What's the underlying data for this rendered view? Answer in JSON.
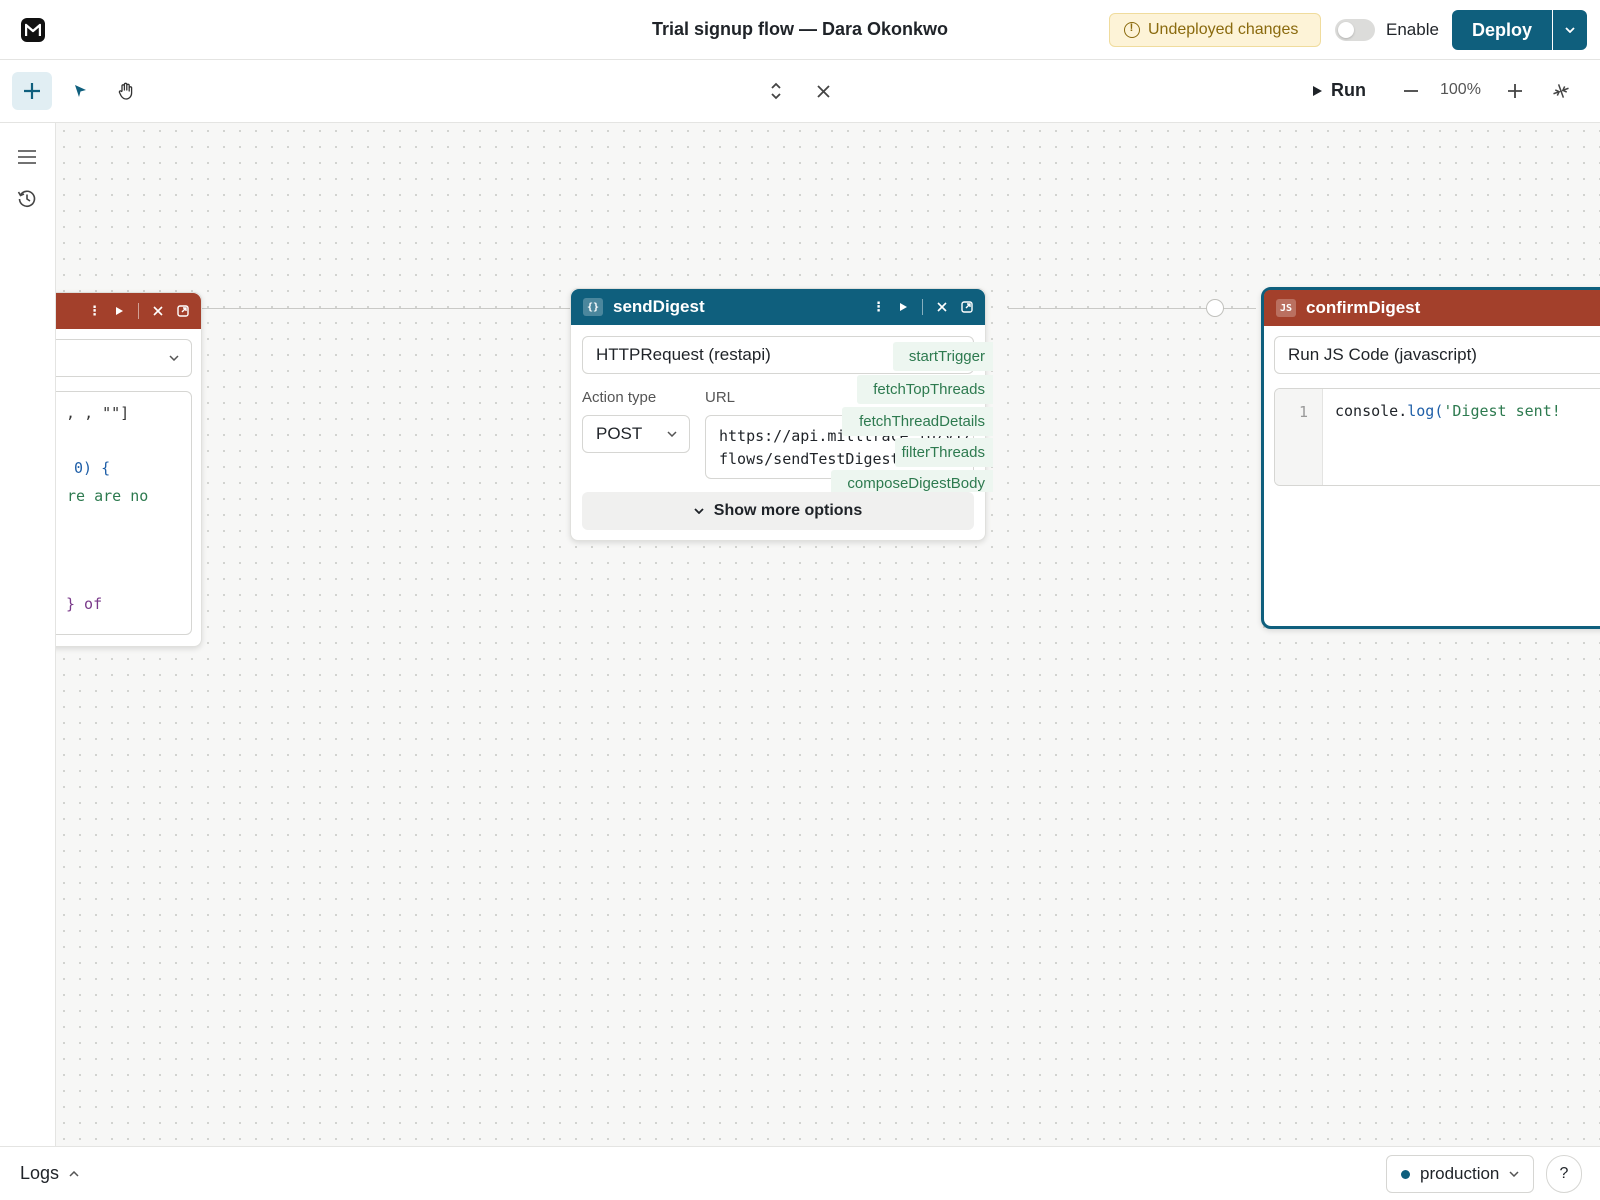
{
  "header": {
    "title": "Trial signup flow — Dara Okonkwo",
    "badge_label": "Undeployed changes",
    "enable_label": "Enable",
    "deploy_label": "Deploy"
  },
  "toolbar": {
    "run_label": "Run",
    "zoom_label": "100%"
  },
  "nodes": {
    "left": {
      "code_lines": [
        ", \"\"]",
        "0) {",
        "re are no",
        "} of"
      ]
    },
    "send_digest": {
      "name": "sendDigest",
      "type_icon": "{}",
      "resource": "HTTPRequest (restapi)",
      "action_type_label": "Action type",
      "action_type_value": "POST",
      "url_label": "URL",
      "url_line1": "https://api.milltrace.io/v1/",
      "url_line2": "flows/sendTestDigest",
      "show_more_label": "Show more options",
      "suggestions": [
        "startTrigger",
        "fetchTopThreads",
        "fetchThreadDetails",
        "filterThreads",
        "composeDigestBody"
      ]
    },
    "confirm_digest": {
      "name": "confirmDigest",
      "type_icon": "JS",
      "resource": "Run JS Code (javascript)",
      "line_number": "1",
      "code_obj": "console.",
      "code_fn": "log(",
      "code_str": "'Digest sent!"
    }
  },
  "footer": {
    "logs_label": "Logs",
    "environment": "production",
    "help_label": "?"
  },
  "colors": {
    "brand": "#0f5f7d",
    "js_node": "#a3402b",
    "warning_bg": "#fdf3d7"
  }
}
